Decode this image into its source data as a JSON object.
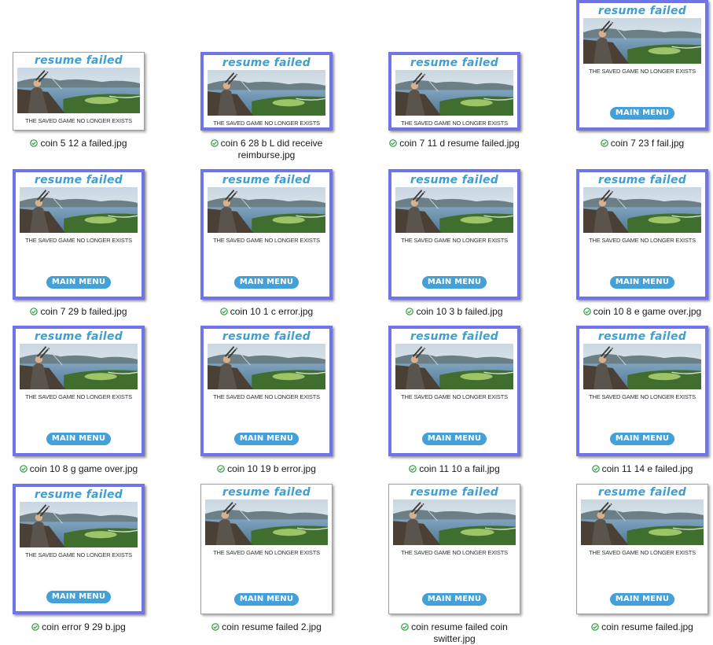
{
  "explorer": {
    "view": "large-icons",
    "sync_status_icon": "green-check-circle-icon",
    "colors": {
      "selection_border": "#6f74e6",
      "title_blue": "#3f9fd3",
      "button_blue": "#43a0d8",
      "check_green": "#2e9e3f"
    }
  },
  "thumbnail_content": {
    "title": "resume failed",
    "message": "THE SAVED GAME NO LONGER EXISTS",
    "button": "MAIN MENU"
  },
  "files": [
    {
      "name": "coin 5 12 a failed.jpg",
      "style": "thin",
      "has_button": false
    },
    {
      "name": "coin 6 28 b L did receive reimburse.jpg",
      "style": "blue",
      "has_button": false
    },
    {
      "name": "coin 7 11 d resume failed.jpg",
      "style": "blue",
      "has_button": false
    },
    {
      "name": "coin 7 23 f fail.jpg",
      "style": "blue",
      "has_button": true
    },
    {
      "name": "coin 7 29 b failed.jpg",
      "style": "blue",
      "has_button": true
    },
    {
      "name": "coin 10 1 c error.jpg",
      "style": "blue",
      "has_button": true
    },
    {
      "name": "coin 10 3 b failed.jpg",
      "style": "blue",
      "has_button": true
    },
    {
      "name": "coin 10 8 e game over.jpg",
      "style": "blue",
      "has_button": true
    },
    {
      "name": "coin 10 8 g game over.jpg",
      "style": "blue",
      "has_button": true
    },
    {
      "name": "coin 10 19 b error.jpg",
      "style": "blue",
      "has_button": true
    },
    {
      "name": "coin 11 10 a fail.jpg",
      "style": "blue",
      "has_button": true
    },
    {
      "name": "coin 11 14 e failed.jpg",
      "style": "blue",
      "has_button": true
    },
    {
      "name": "coin error 9 29 b.jpg",
      "style": "blue",
      "has_button": true
    },
    {
      "name": "coin resume failed 2.jpg",
      "style": "thin",
      "has_button": true
    },
    {
      "name": "coin resume failed coin switter.jpg",
      "style": "thin",
      "has_button": true
    },
    {
      "name": "coin resume failed.jpg",
      "style": "thin",
      "has_button": true
    }
  ]
}
